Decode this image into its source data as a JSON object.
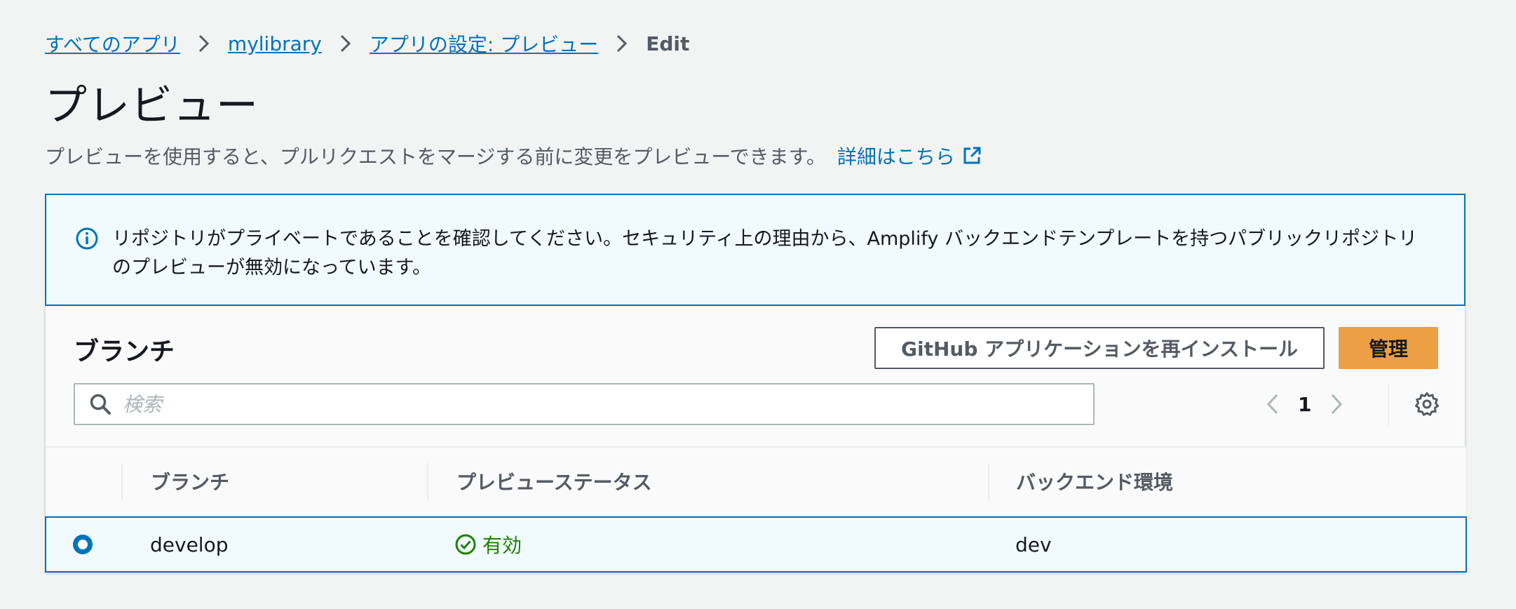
{
  "breadcrumb": {
    "items": [
      "すべてのアプリ",
      "mylibrary",
      "アプリの設定: プレビュー"
    ],
    "current": "Edit"
  },
  "page": {
    "title": "プレビュー",
    "description": "プレビューを使用すると、プルリクエストをマージする前に変更をプレビューできます。",
    "learn_more": "詳細はこちら"
  },
  "alert": {
    "text": "リポジトリがプライベートであることを確認してください。セキュリティ上の理由から、Amplify バックエンドテンプレートを持つパブリックリポジトリのプレビューが無効になっています。"
  },
  "branches": {
    "title": "ブランチ",
    "reinstall_button": "GitHub アプリケーションを再インストール",
    "manage_button": "管理",
    "search_placeholder": "検索",
    "page_number": "1",
    "columns": [
      "ブランチ",
      "プレビューステータス",
      "バックエンド環境"
    ],
    "rows": [
      {
        "branch": "develop",
        "status": "有効",
        "backend": "dev",
        "selected": true
      }
    ]
  },
  "colors": {
    "link": "#0073bb",
    "primary_button": "#ec9f44",
    "success": "#1d8102",
    "background": "#f2f3f3"
  },
  "icons": [
    "chevron-right-icon",
    "external-link-icon",
    "info-icon",
    "search-icon",
    "chevron-left-icon",
    "settings-icon",
    "status-success-icon"
  ]
}
